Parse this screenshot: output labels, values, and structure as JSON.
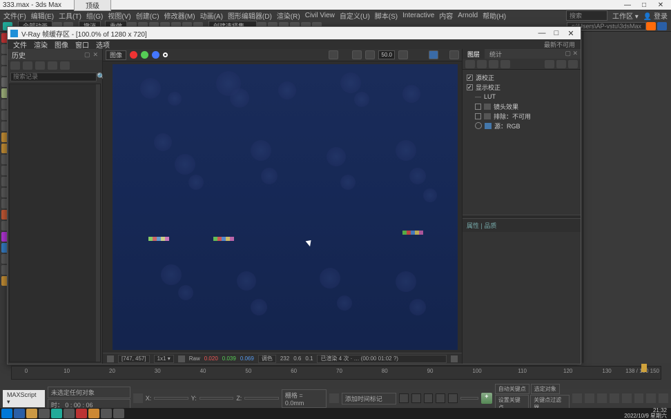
{
  "max": {
    "title": "333.max - 3ds Max",
    "tab": "顶级",
    "menu": [
      "文件(F)",
      "编辑(E)",
      "工具(T)",
      "组(G)",
      "视图(V)",
      "创建(C)",
      "修改器(M)",
      "动画(A)",
      "图形编辑器(D)",
      "渲染(R)",
      "Civil View",
      "自定义(U)",
      "脚本(S)",
      "Interactive",
      "内容",
      "Arnold",
      "帮助(H)"
    ],
    "search_placeholder": "搜索",
    "ws": "工作区 ▾",
    "toolbar_select": "全部动画",
    "toolbar_opt1": "撤消",
    "toolbar_opt2": "重做",
    "sel2": "创建选择集",
    "path": "c:\\Users\\AP-vstu\\3dsMax"
  },
  "vray": {
    "title": "V-Ray 帧缓存区 - [100.0% of 1280 x 720]",
    "menu": [
      "文件",
      "渲染",
      "图像",
      "窗口",
      "选项"
    ],
    "menu_right": "最新不可用",
    "channel": "图像",
    "zoom": "50.0",
    "history_title": "历史",
    "search_placeholder": "搜索记录",
    "cursor_pos": "[747, 457]",
    "scale": "1x1 ▾",
    "raw": "Raw",
    "rgb_r": "0.020",
    "rgb_g": "0.039",
    "rgb_b": "0.069",
    "stat_lbl": "调色",
    "stat_num1": "232",
    "stat_num2": "0.6",
    "stat_num3": "0.1",
    "status_long": "已渲染 4 次 · … (00:00 01:02 ?)",
    "right_tab1": "图层",
    "right_tab2": "统计",
    "tree": {
      "n1": "源校正",
      "n2": "显示校正",
      "n3": "LUT",
      "n4": "镜头效果",
      "n5": "排除：不可用",
      "n6": "源：RGB"
    },
    "props_title": "属性 | 品质"
  },
  "timeline": {
    "ticks": [
      "0",
      "10",
      "20",
      "30",
      "40",
      "50",
      "60",
      "70",
      "80",
      "90",
      "100",
      "110",
      "120",
      "130",
      "138 / 150 150"
    ]
  },
  "bottom": {
    "script": "MAXScript ▾",
    "sel": "未选定任何对象",
    "time": "时：  0 : 00 : 06",
    "x": "X:",
    "y": "Y:",
    "z": "Z:",
    "grid": "栅格 = 0.0mm",
    "snap": "添加时间标记",
    "k1": "自动关键点",
    "k2": "选定对象",
    "k3": "设置关键点",
    "k4": "关键点过滤器"
  },
  "task": {
    "clock": "21:32",
    "date": "2022/10/9 星期六"
  }
}
